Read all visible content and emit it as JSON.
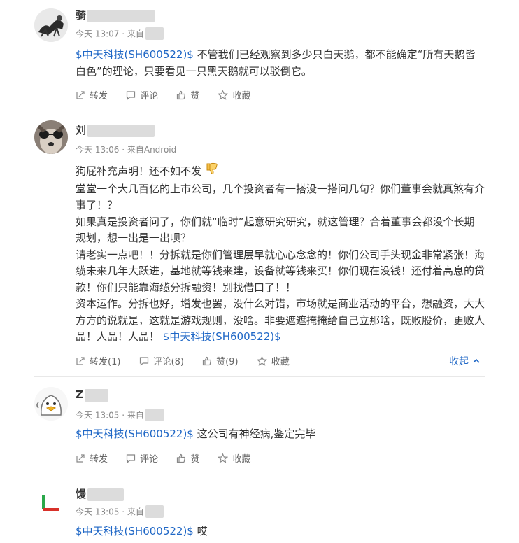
{
  "posts": [
    {
      "user": "骑",
      "time": "今天 13:07",
      "source": "· 来自",
      "segments": [
        {
          "type": "stock",
          "text": "$中天科技(SH600522)$"
        },
        {
          "type": "text",
          "text": " 不管我们已经观察到多少只白天鹅，都不能确定“所有天鹅皆白色”的理论，只要看见一只黑天鹅就可以驳倒它。"
        }
      ],
      "actions": {
        "repost": "转发",
        "comment": "评论",
        "like": "赞",
        "fav": "收藏"
      }
    },
    {
      "user": "刘",
      "time": "今天 13:06",
      "source": "· 来自Android",
      "segments": [
        {
          "type": "text",
          "text": "狗屁补充声明！还不如不发 "
        },
        {
          "type": "emoji",
          "text": ""
        },
        {
          "type": "br",
          "text": ""
        },
        {
          "type": "text",
          "text": "堂堂一个大几百亿的上市公司，几个投资者有一搭没一搭问几句？你们董事会就真煞有介事了！？"
        },
        {
          "type": "br",
          "text": ""
        },
        {
          "type": "text",
          "text": "如果真是投资者问了，你们就“临时”起意研究研究，就这管理？合着董事会都没个长期规划，想一出是一出呗？"
        },
        {
          "type": "br",
          "text": ""
        },
        {
          "type": "text",
          "text": "请老实一点吧！！分拆就是你们管理层早就心心念念的！你们公司手头现金非常紧张！海缆未来几年大跃进，基地就等钱来建，设备就等钱来买！你们现在没钱！还付着高息的贷款！你们只能靠海缆分拆融资！别找借口了！！"
        },
        {
          "type": "br",
          "text": ""
        },
        {
          "type": "text",
          "text": "资本运作。分拆也好，增发也罢，没什么对错，市场就是商业活动的平台，想融资，大大方方的说就是，这就是游戏规则，没啥。非要遮遮掩掩给自己立那啥，既败股价，更败人品！人品！人品！ "
        },
        {
          "type": "stock",
          "text": "$中天科技(SH600522)$"
        }
      ],
      "actions": {
        "repost": "转发(1)",
        "comment": "评论(8)",
        "like": "赞(9)",
        "fav": "收藏"
      },
      "collapse": "收起"
    },
    {
      "user": "Z",
      "time": "今天 13:05",
      "source": "· 来自",
      "segments": [
        {
          "type": "stock",
          "text": "$中天科技(SH600522)$"
        },
        {
          "type": "text",
          "text": " 这公司有神经病,鉴定完毕"
        }
      ],
      "actions": {
        "repost": "转发",
        "comment": "评论",
        "like": "赞",
        "fav": "收藏"
      }
    },
    {
      "user": "馒",
      "time": "今天 13:05",
      "source": "· 来自",
      "segments": [
        {
          "type": "stock",
          "text": "$中天科技(SH600522)$"
        },
        {
          "type": "text",
          "text": " 哎"
        }
      ]
    }
  ],
  "colors": {
    "link": "#1f67c6",
    "text": "#333333",
    "meta": "#888888"
  }
}
